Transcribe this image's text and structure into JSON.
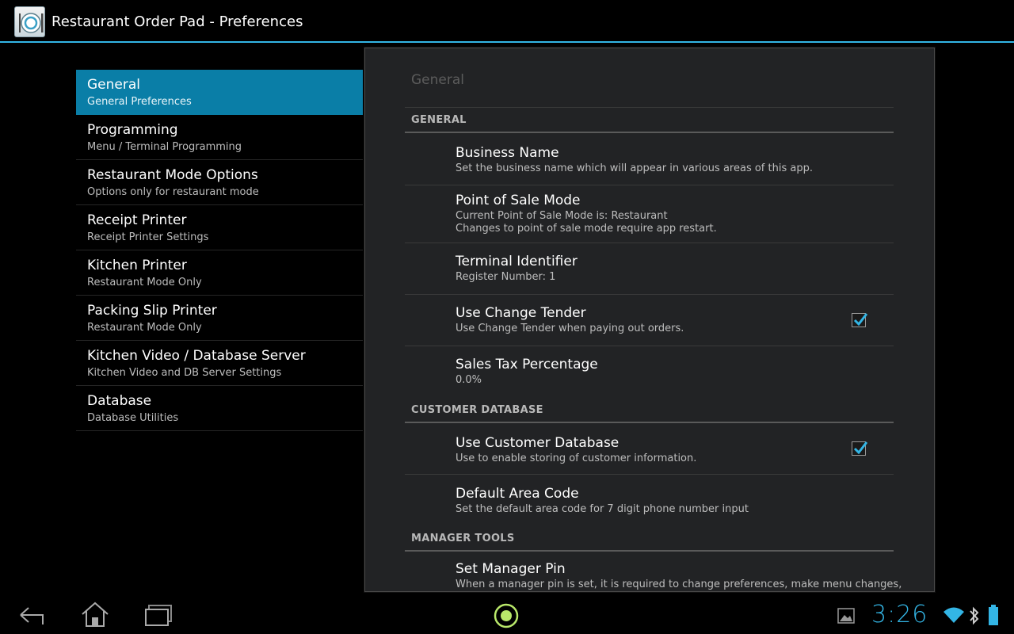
{
  "app": {
    "title": "Restaurant Order Pad - Preferences",
    "icon": "plate-fork-knife-icon",
    "accent": "#33b5e5",
    "selected_bg": "#0a7ea7"
  },
  "headers": [
    {
      "title": "General",
      "summary": "General Preferences",
      "selected": true
    },
    {
      "title": "Programming",
      "summary": "Menu / Terminal Programming"
    },
    {
      "title": "Restaurant Mode Options",
      "summary": "Options only for restaurant mode"
    },
    {
      "title": "Receipt Printer",
      "summary": "Receipt Printer Settings"
    },
    {
      "title": "Kitchen Printer",
      "summary": "Restaurant Mode Only"
    },
    {
      "title": "Packing Slip Printer",
      "summary": "Restaurant Mode Only"
    },
    {
      "title": "Kitchen Video / Database Server",
      "summary": "Kitchen Video and DB Server Settings"
    },
    {
      "title": "Database",
      "summary": "Database Utilities"
    }
  ],
  "panel": {
    "breadcrumb": "General",
    "categories": [
      {
        "title": "GENERAL",
        "prefs": [
          {
            "title": "Business Name",
            "summary": "Set the business name which will appear in various areas of this app."
          },
          {
            "title": "Point of Sale Mode",
            "summary": "Current Point of Sale Mode is: Restaurant",
            "summary2": "Changes to point of sale mode require app restart."
          },
          {
            "title": "Terminal Identifier",
            "summary": "Register Number: 1"
          },
          {
            "title": "Use Change Tender",
            "summary": "Use Change Tender when paying out orders.",
            "checked": true
          },
          {
            "title": "Sales Tax Percentage",
            "summary": "0.0%"
          }
        ]
      },
      {
        "title": "CUSTOMER DATABASE",
        "prefs": [
          {
            "title": "Use Customer Database",
            "summary": "Use to enable storing of customer information.",
            "checked": true
          },
          {
            "title": "Default Area Code",
            "summary": "Set the default area code for 7 digit phone number input"
          }
        ]
      },
      {
        "title": "MANAGER TOOLS",
        "prefs": [
          {
            "title": "Set Manager Pin",
            "summary": "When a manager pin is set, it is required to change preferences, make menu changes,"
          }
        ]
      }
    ]
  },
  "navbar": {
    "back_icon": "back-icon",
    "home_icon": "home-icon",
    "recents_icon": "recent-apps-icon",
    "center_icon": "app-indicator-icon",
    "gallery_icon": "gallery-notification-icon",
    "wifi_icon": "wifi-icon",
    "bluetooth_icon": "bluetooth-icon",
    "battery_icon": "battery-icon",
    "clock": "3:26"
  }
}
